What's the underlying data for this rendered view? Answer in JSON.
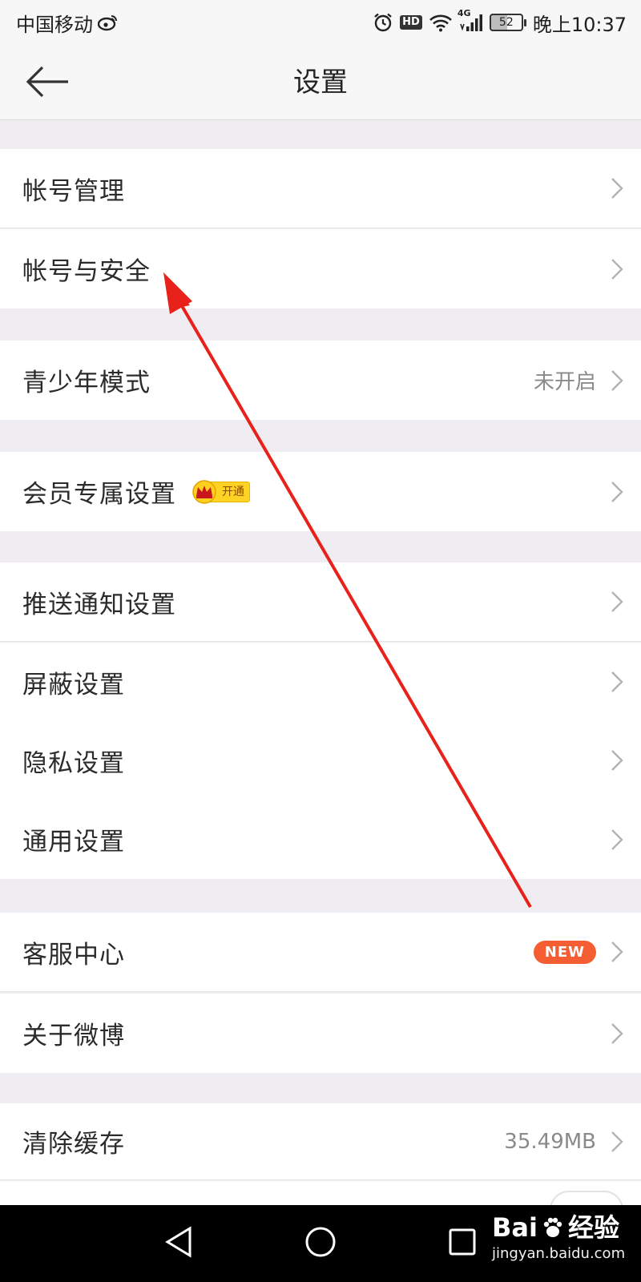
{
  "status_bar": {
    "carrier": "中国移动",
    "network_label": "4G",
    "hd_label": "HD",
    "battery_level": "52",
    "time": "晚上10:37"
  },
  "nav": {
    "title": "设置",
    "back_icon": "back-arrow-icon"
  },
  "sections": [
    {
      "items": [
        {
          "label": "帐号管理"
        },
        {
          "label": "帐号与安全"
        }
      ]
    },
    {
      "items": [
        {
          "label": "青少年模式",
          "value": "未开启"
        }
      ]
    },
    {
      "items": [
        {
          "label": "会员专属设置",
          "badge": "开通"
        }
      ]
    },
    {
      "items": [
        {
          "label": "推送通知设置"
        },
        {
          "label": "屏蔽设置"
        },
        {
          "label": "隐私设置"
        },
        {
          "label": "通用设置"
        }
      ]
    },
    {
      "items": [
        {
          "label": "客服中心",
          "badge": "NEW"
        },
        {
          "label": "关于微博"
        }
      ]
    },
    {
      "items": [
        {
          "label": "清除缓存",
          "value": "35.49MB"
        }
      ]
    }
  ],
  "colors": {
    "background": "#efedf1",
    "row_background": "#ffffff",
    "new_badge": "#f55d32",
    "vip_badge": "#ffd323",
    "annotation_arrow": "#e8221b"
  },
  "watermark": {
    "brand_latin": "Bai",
    "brand_suffix": "经验",
    "url": "jingyan.baidu.com"
  }
}
